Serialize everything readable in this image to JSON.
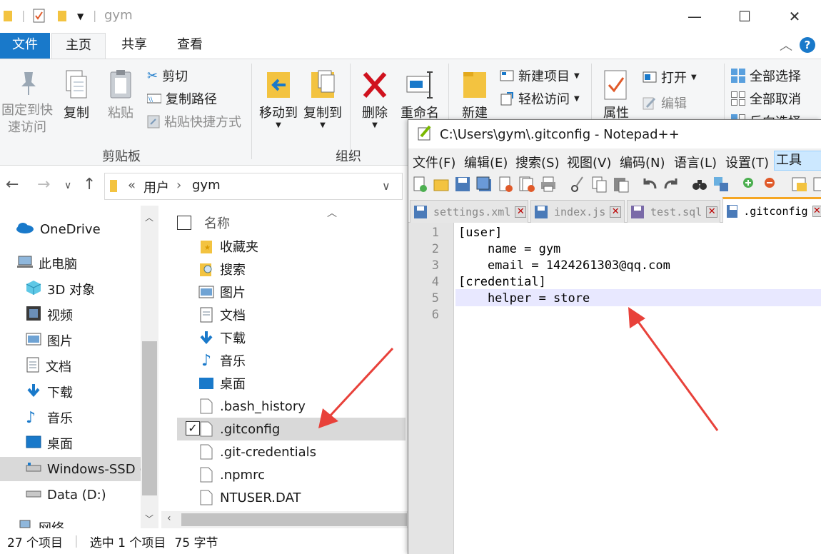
{
  "explorer": {
    "title": "gym",
    "window_controls": {
      "minimize": "—",
      "maximize": "☐",
      "close": "✕"
    },
    "tabs": {
      "file": "文件",
      "home": "主页",
      "share": "共享",
      "view": "查看"
    },
    "help": "?",
    "ribbon": {
      "pin_label_1": "固定到快",
      "pin_label_2": "速访问",
      "copy": "复制",
      "paste": "粘贴",
      "cut": "剪切",
      "copy_path": "复制路径",
      "paste_shortcut": "粘贴快捷方式",
      "clipboard_group": "剪贴板",
      "move_to": "移动到",
      "copy_to": "复制到",
      "delete": "删除",
      "rename": "重命名",
      "organize_group": "组织",
      "new_folder": "新建",
      "new_item": "新建项目",
      "easy_access": "轻松访问",
      "properties": "属性",
      "open": "打开",
      "edit": "编辑",
      "select_all": "全部选择",
      "select_none": "全部取消",
      "invert": "反向选择"
    },
    "address": {
      "prefix": "«",
      "crumb1": "用户",
      "crumb2": "gym"
    },
    "nav": [
      {
        "label": "OneDrive"
      },
      {
        "label": "此电脑"
      },
      {
        "label": "3D 对象"
      },
      {
        "label": "视频"
      },
      {
        "label": "图片"
      },
      {
        "label": "文档"
      },
      {
        "label": "下载"
      },
      {
        "label": "音乐"
      },
      {
        "label": "桌面"
      },
      {
        "label": "Windows-SSD ("
      },
      {
        "label": "Data (D:)"
      },
      {
        "label": "网络"
      }
    ],
    "column_header": "名称",
    "files": [
      {
        "name": "收藏夹"
      },
      {
        "name": "搜索"
      },
      {
        "name": "图片"
      },
      {
        "name": "文档"
      },
      {
        "name": "下载"
      },
      {
        "name": "音乐"
      },
      {
        "name": "桌面"
      },
      {
        "name": ".bash_history"
      },
      {
        "name": ".gitconfig"
      },
      {
        "name": ".git-credentials"
      },
      {
        "name": ".npmrc"
      },
      {
        "name": "NTUSER.DAT"
      }
    ],
    "status": {
      "count": "27 个项目",
      "selected": "选中 1 个项目",
      "size": "75 字节"
    }
  },
  "notepad": {
    "title": "C:\\Users\\gym\\.gitconfig - Notepad++",
    "menu": [
      "文件(F)",
      "编辑(E)",
      "搜索(S)",
      "视图(V)",
      "编码(N)",
      "语言(L)",
      "设置(T)",
      "工具(O)"
    ],
    "tabs": [
      {
        "name": "settings.xml"
      },
      {
        "name": "index.js"
      },
      {
        "name": "test.sql"
      },
      {
        "name": ".gitconfig"
      }
    ],
    "lines": [
      "[user]",
      "    name = gym",
      "    email = 1424261303@qq.com",
      "[credential]",
      "    helper = store",
      ""
    ],
    "line_numbers": [
      "1",
      "2",
      "3",
      "4",
      "5",
      "6"
    ]
  },
  "colors": {
    "accent": "#1979ca",
    "arrow": "#e8413a",
    "tab_active": "#f5a623",
    "selection": "#cce8ff"
  }
}
